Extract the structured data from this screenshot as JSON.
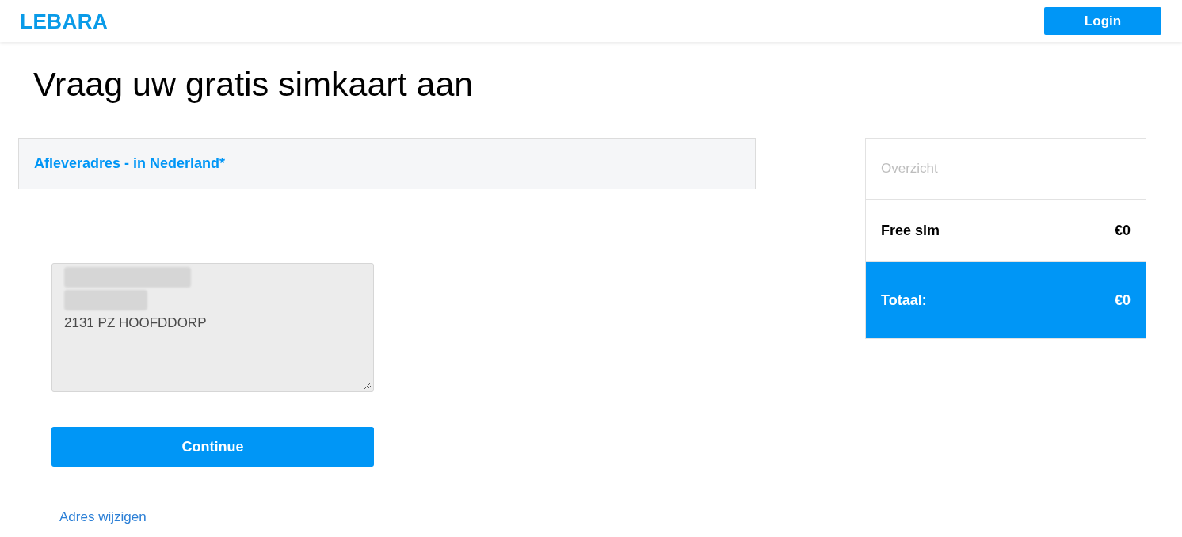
{
  "header": {
    "logo": "LEBARA",
    "login_button": "Login"
  },
  "page_title": "Vraag uw gratis simkaart aan",
  "delivery": {
    "heading": "Afleveradres - in Nederland*",
    "address_field": {
      "lines": [
        {
          "kind": "redacted"
        },
        {
          "kind": "redacted"
        },
        {
          "kind": "text",
          "text": "2131 PZ HOOFDDORP"
        }
      ]
    },
    "continue_button": "Continue",
    "change_address_link": "Adres wijzigen"
  },
  "summary": {
    "title": "Overzicht",
    "rows": [
      {
        "kind": "item",
        "label": "Free sim",
        "value": "€0"
      },
      {
        "kind": "total",
        "label": "Totaal:",
        "value": "€0"
      }
    ]
  }
}
